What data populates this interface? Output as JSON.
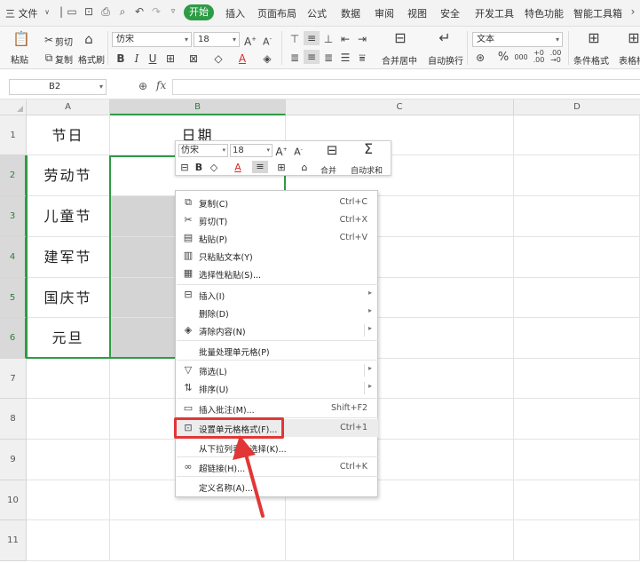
{
  "menubar": {
    "menu_file": "三 文件",
    "tabs": [
      "开始",
      "插入",
      "页面布局",
      "公式",
      "数据",
      "审阅",
      "视图",
      "安全",
      "开发工具",
      "特色功能",
      "智能工具箱"
    ],
    "active_tab": "开始"
  },
  "ribbon": {
    "paste": "粘贴",
    "cut": "剪切",
    "copy": "复制",
    "format_painter": "格式刷",
    "font_name": "仿宋",
    "font_size": "18",
    "merge_center": "合并居中",
    "wrap_text": "自动换行",
    "number_format": "文本",
    "conditional_format": "条件格式",
    "table_style": "表格样"
  },
  "formula_bar": {
    "name_box": "B2",
    "fx": "fx",
    "formula": ""
  },
  "sheet": {
    "columns": [
      "A",
      "B",
      "C",
      "D"
    ],
    "rows": [
      "1",
      "2",
      "3",
      "4",
      "5",
      "6",
      "7",
      "8",
      "9",
      "10",
      "11"
    ],
    "a_values": [
      "节日",
      "劳动节",
      "儿童节",
      "建军节",
      "国庆节",
      "元旦"
    ],
    "b1": "日期"
  },
  "mini_toolbar": {
    "font_name": "仿宋",
    "font_size": "18",
    "merge": "合并",
    "autosum": "自动求和"
  },
  "context_menu": {
    "items": [
      {
        "label": "复制(C)",
        "shortcut": "Ctrl+C",
        "icon": "copy-icon"
      },
      {
        "label": "剪切(T)",
        "shortcut": "Ctrl+X",
        "icon": "scissors-icon"
      },
      {
        "label": "粘贴(P)",
        "shortcut": "Ctrl+V",
        "icon": "paste-icon"
      },
      {
        "label": "只粘贴文本(Y)",
        "shortcut": "",
        "icon": "paste-text-icon"
      },
      {
        "label": "选择性粘贴(S)...",
        "shortcut": "",
        "icon": "paste-special-icon"
      },
      {
        "label": "插入(I)",
        "shortcut": "",
        "icon": "insert-icon"
      },
      {
        "label": "删除(D)",
        "shortcut": "",
        "icon": ""
      },
      {
        "label": "清除内容(N)",
        "shortcut": "",
        "icon": "eraser-icon"
      },
      {
        "label": "批量处理单元格(P)",
        "shortcut": "",
        "icon": ""
      },
      {
        "label": "筛选(L)",
        "shortcut": "",
        "icon": "filter-icon"
      },
      {
        "label": "排序(U)",
        "shortcut": "",
        "icon": "sort-icon"
      },
      {
        "label": "插入批注(M)...",
        "shortcut": "Shift+F2",
        "icon": "comment-icon"
      },
      {
        "label": "设置单元格格式(F)...",
        "shortcut": "Ctrl+1",
        "icon": "format-cells-icon"
      },
      {
        "label": "从下拉列表中选择(K)...",
        "shortcut": "",
        "icon": ""
      },
      {
        "label": "超链接(H)...",
        "shortcut": "Ctrl+K",
        "icon": "link-icon"
      },
      {
        "label": "定义名称(A)...",
        "shortcut": "",
        "icon": ""
      }
    ],
    "highlighted": "设置单元格格式(F)..."
  },
  "colors": {
    "accent": "#2e9b45",
    "annotation": "#e23636",
    "selection_shade": "#d4d4d4"
  }
}
